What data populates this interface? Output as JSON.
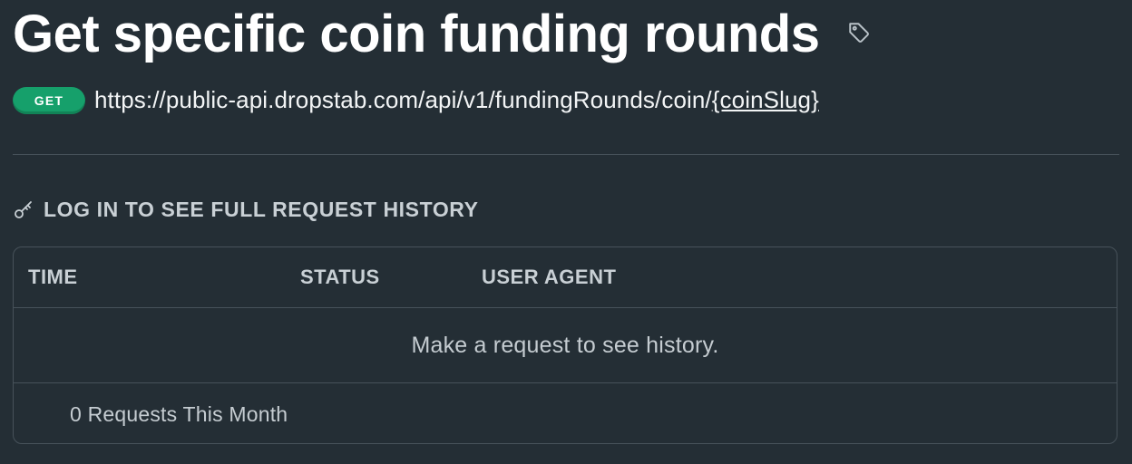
{
  "page": {
    "title": "Get specific coin funding rounds"
  },
  "endpoint": {
    "method": "GET",
    "url_base": "https://public-api.dropstab.com/api/v1/fundingRounds/coin/",
    "url_param": "{coinSlug}",
    "method_color": "#16a06b"
  },
  "history": {
    "login_label": "LOG IN TO SEE FULL REQUEST HISTORY",
    "columns": {
      "time": "TIME",
      "status": "STATUS",
      "user_agent": "USER AGENT"
    },
    "empty_message": "Make a request to see history.",
    "footer_count": "0 Requests This Month"
  },
  "icons": {
    "tag": "tag-icon",
    "key": "key-icon"
  },
  "colors": {
    "background": "#242e35",
    "border": "#47525a",
    "muted_text": "#c9d0d5"
  }
}
